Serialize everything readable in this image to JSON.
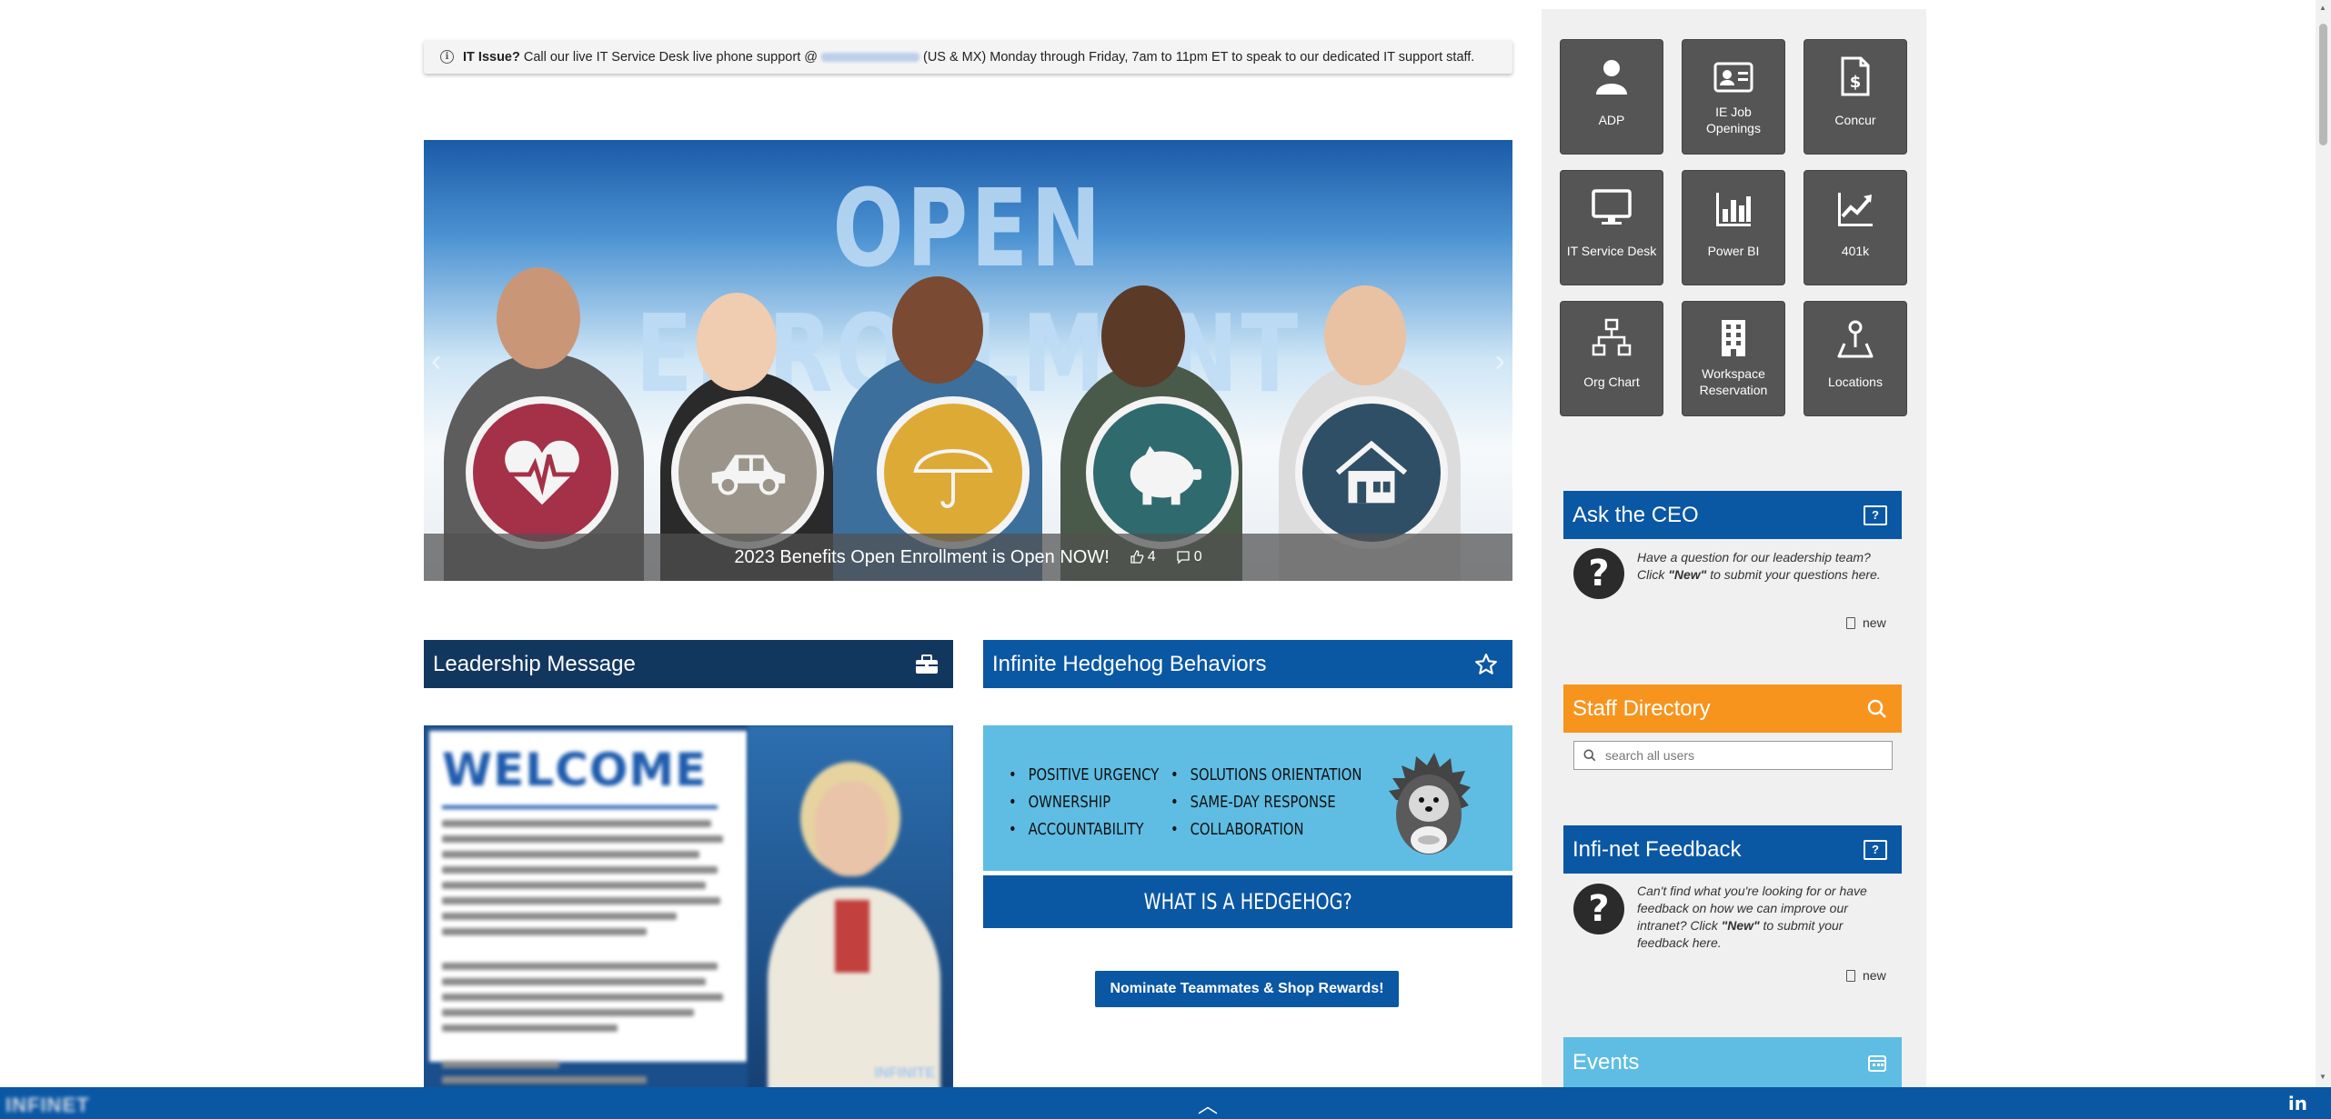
{
  "alert": {
    "bold": "IT Issue?",
    "text_before": "Call our live IT Service Desk live phone support @",
    "phone": "1-800-000-8759",
    "text_after": "(US & MX) Monday through Friday, 7am to 11pm ET to speak to our dedicated IT support staff."
  },
  "hero": {
    "title": "OPEN ENROLLMENT",
    "caption": "2023 Benefits Open Enrollment is Open NOW!",
    "likes": "4",
    "comments": "0",
    "icons": [
      "heart-icon",
      "car-icon",
      "umbrella-icon",
      "piggy-bank-icon",
      "house-icon"
    ]
  },
  "leadership": {
    "header": "Leadership Message",
    "icon": "briefcase-icon",
    "image": {
      "title": "WELCOME",
      "brand": "INFINITE"
    }
  },
  "hedgehog": {
    "header": "Infinite Hedgehog Behaviors",
    "icon": "star-icon",
    "col1": [
      "POSITIVE URGENCY",
      "OWNERSHIP",
      "ACCOUNTABILITY"
    ],
    "col2": [
      "SOLUTIONS ORIENTATION",
      "SAME-DAY RESPONSE",
      "COLLABORATION"
    ],
    "bar": "WHAT IS A HEDGEHOG?",
    "button": "Nominate Teammates & Shop Rewards!"
  },
  "tiles": [
    {
      "label": "ADP",
      "icon": "person-icon"
    },
    {
      "label": "IE Job Openings",
      "icon": "id-card-icon"
    },
    {
      "label": "Concur",
      "icon": "invoice-icon"
    },
    {
      "label": "IT Service Desk",
      "icon": "monitor-icon"
    },
    {
      "label": "Power BI",
      "icon": "bar-chart-icon"
    },
    {
      "label": "401k",
      "icon": "trend-chart-icon"
    },
    {
      "label": "Org Chart",
      "icon": "org-chart-icon"
    },
    {
      "label": "Workspace Reservation",
      "icon": "building-icon"
    },
    {
      "label": "Locations",
      "icon": "map-pin-icon"
    }
  ],
  "ceo": {
    "header": "Ask the CEO",
    "text_a": "Have a question for our leadership team? Click",
    "text_bold": "\"New\"",
    "text_b": "to submit your questions here.",
    "new": "new"
  },
  "staff": {
    "header": "Staff Directory",
    "placeholder": "search all users"
  },
  "feedback": {
    "header": "Infi-net Feedback",
    "text_a": "Can't find what you're looking for or have feedback on how we can improve our intranet? Click",
    "text_bold": "\"New\"",
    "text_b": "to submit your feedback here.",
    "new": "new"
  },
  "events": {
    "header": "Events"
  },
  "footer": {
    "logo": "INFINET",
    "linkedin": "in"
  },
  "colors": {
    "navy": "#12375f",
    "blue": "#0a57a4",
    "orange": "#f7941e",
    "light_blue": "#5fbde3",
    "tile": "#555555"
  }
}
